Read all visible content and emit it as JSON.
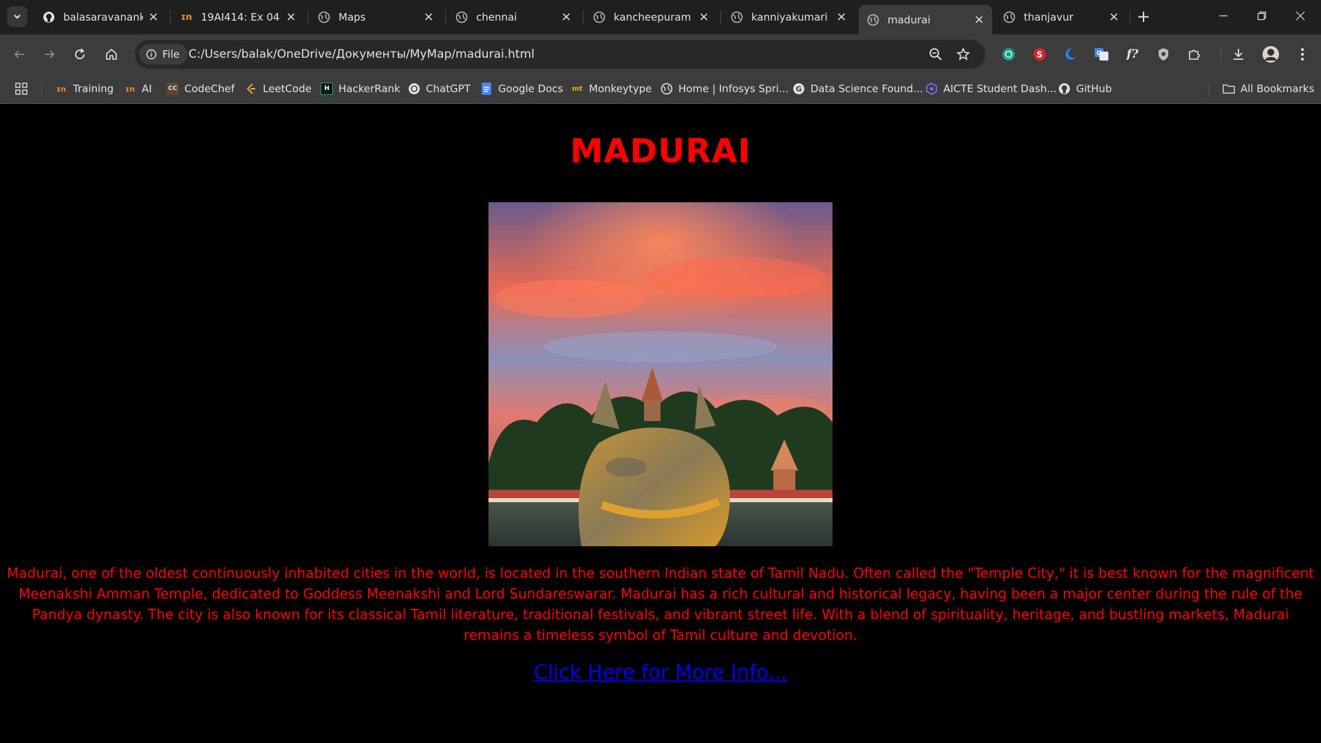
{
  "tabs": [
    {
      "title": "balasaravanank/",
      "icon": "github-icon",
      "active": false
    },
    {
      "title": "19AI414: Ex 04 -",
      "icon": "infosys-icon",
      "active": false
    },
    {
      "title": "Maps",
      "icon": "globe-icon",
      "active": false
    },
    {
      "title": "chennai",
      "icon": "globe-icon",
      "active": false
    },
    {
      "title": "kancheepuram",
      "icon": "globe-icon",
      "active": false
    },
    {
      "title": "kanniyakumari",
      "icon": "globe-icon",
      "active": false
    },
    {
      "title": "madurai",
      "icon": "globe-icon",
      "active": true
    },
    {
      "title": "thanjavur",
      "icon": "globe-icon",
      "active": false
    }
  ],
  "toolbar": {
    "site_chip": "File",
    "url": "C:/Users/balak/OneDrive/Документы/MyMap/madurai.html"
  },
  "bookmarks": [
    {
      "label": "Training",
      "icon": "infosys-icon"
    },
    {
      "label": "AI",
      "icon": "infosys-icon"
    },
    {
      "label": "CodeChef",
      "icon": "codechef-icon"
    },
    {
      "label": "LeetCode",
      "icon": "leetcode-icon"
    },
    {
      "label": "HackerRank",
      "icon": "hackerrank-icon"
    },
    {
      "label": "ChatGPT",
      "icon": "chatgpt-icon"
    },
    {
      "label": "Google Docs",
      "icon": "docs-icon"
    },
    {
      "label": "Monkeytype",
      "icon": "monkeytype-icon"
    },
    {
      "label": "Home | Infosys Spri...",
      "icon": "globe-icon"
    },
    {
      "label": "Data Science Found...",
      "icon": "google-icon"
    },
    {
      "label": "AICTE Student Dash...",
      "icon": "aicte-icon"
    },
    {
      "label": "GitHub",
      "icon": "github-icon"
    }
  ],
  "all_bookmarks": "All Bookmarks",
  "page": {
    "title": "MADURAI",
    "description": "Madurai, one of the oldest continuously inhabited cities in the world, is located in the southern Indian state of Tamil Nadu. Often called the \"Temple City,\" it is best known for the magnificent Meenakshi Amman Temple, dedicated to Goddess Meenakshi and Lord Sundareswarar. Madurai has a rich cultural and historical legacy, having been a major center during the rule of the Pandya dynasty. The city is also known for its classical Tamil literature, traditional festivals, and vibrant street life. With a blend of spirituality, heritage, and bustling markets, Madurai remains a timeless symbol of Tamil culture and devotion.",
    "link_text": "Click Here for More Info..."
  },
  "colors": {
    "title": "#ff0000",
    "description": "#ff0000",
    "link": "#0000ee",
    "background": "#000000"
  }
}
